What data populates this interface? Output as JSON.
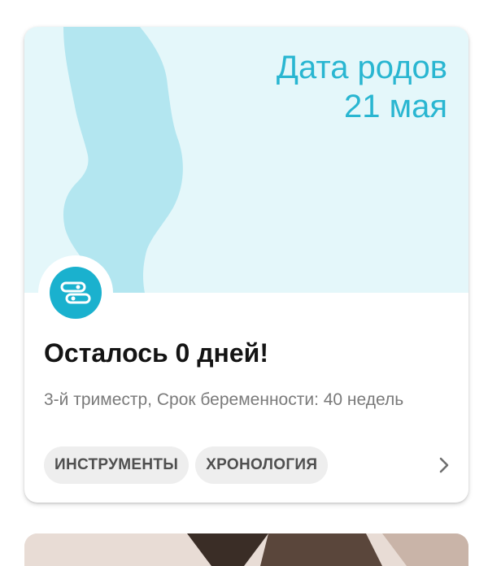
{
  "card": {
    "due_label": "Дата родов",
    "due_date": "21 мая",
    "days_left": "Осталось 0 дней!",
    "details": "3-й триместр, Срок беременности: 40 недель",
    "badge_icon": "pins-icon",
    "chips": [
      {
        "label": "ИНСТРУМЕНТЫ"
      },
      {
        "label": "ХРОНОЛОГИЯ"
      }
    ],
    "more_icon": "chevron-right-icon"
  },
  "colors": {
    "accent": "#29b6d1",
    "hero_bg": "#e4f7fa",
    "silhouette": "#b3e6f0",
    "badge": "#1ab1ce"
  }
}
